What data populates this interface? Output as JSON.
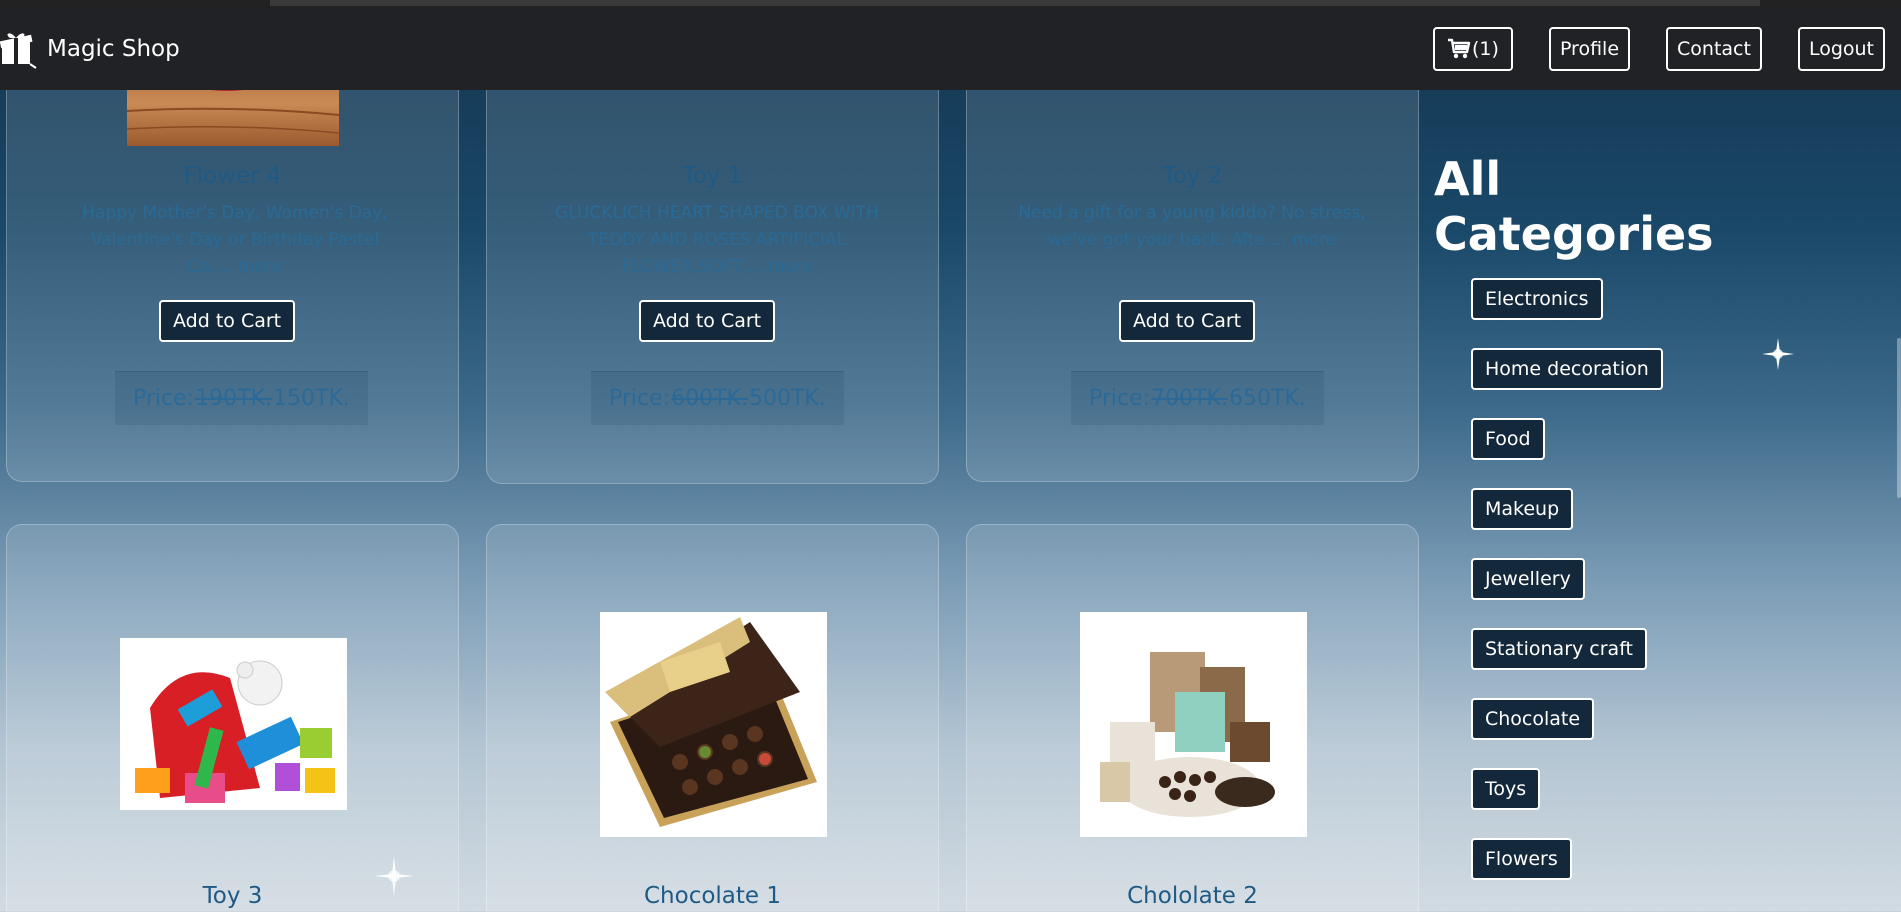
{
  "navbar": {
    "brand": "Magic Shop",
    "cart_label": "(1)",
    "profile": "Profile",
    "contact": "Contact",
    "logout": "Logout"
  },
  "products_top": [
    {
      "title": "Flower 4",
      "desc": "Happy Mother's Day, Women's Day, Valentine's Day or Birthday Pastel Ca....",
      "more": "more",
      "add_label": "Add to Cart",
      "price_label": "Price:",
      "old_price": "190TK.",
      "new_price": "150TK."
    },
    {
      "title": "Toy 1",
      "desc": "GLUCKLICH HEART SHAPED BOX WITH TEDDY AND ROSES ARTIFICIAL FLOWER,SOFT....",
      "more": "more",
      "add_label": "Add to Cart",
      "price_label": "Price:",
      "old_price": "600TK.",
      "new_price": "500TK."
    },
    {
      "title": "Toy 2",
      "desc": "Need a gift for a young kiddo? No stress, we've got your back. Afte....",
      "more": "more",
      "add_label": "Add to Cart",
      "price_label": "Price:",
      "old_price": "700TK.",
      "new_price": "650TK."
    }
  ],
  "products_bottom": [
    {
      "title": "Toy 3"
    },
    {
      "title": "Chocolate 1"
    },
    {
      "title": "Chololate 2"
    }
  ],
  "categories": {
    "title": "All Categories",
    "items": [
      "Electronics",
      "Home decoration",
      "Food",
      "Makeup",
      "Jewellery",
      "Stationary craft",
      "Chocolate",
      "Toys",
      "Flowers"
    ]
  }
}
